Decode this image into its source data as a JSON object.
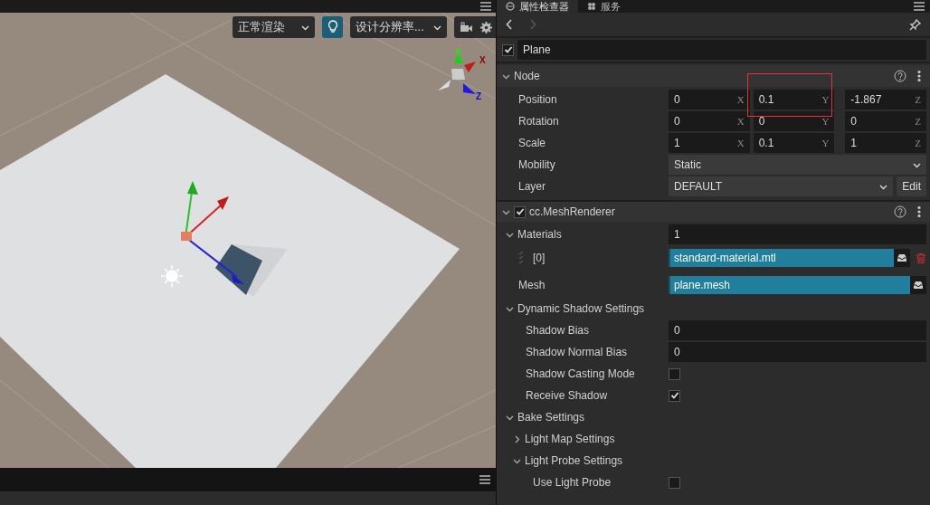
{
  "scene": {
    "toolbar": {
      "render_mode": "正常渲染",
      "light_toggle": {
        "on": true
      },
      "resolution": "设计分辨率..."
    },
    "axis_labels": [
      "Y",
      "X",
      "Z"
    ]
  },
  "inspector": {
    "tabs": [
      {
        "label": "属性检查器",
        "selected": true
      },
      {
        "label": "服务",
        "selected": false
      }
    ],
    "history": {
      "back_disabled": false,
      "forward_disabled": true
    },
    "node": {
      "enabled": true,
      "name": "Plane"
    },
    "annotations": [
      {
        "kind": "rectangle",
        "color": "#e0333a"
      }
    ],
    "sections": [
      {
        "title": "Node",
        "expanded": true,
        "rows": [
          {
            "kind": "vec3",
            "label": "Position",
            "values": [
              {
                "value": "0",
                "axis": "X"
              },
              {
                "value": "0.1",
                "axis": "Y"
              },
              {
                "value": "-1.867",
                "axis": "Z"
              }
            ]
          },
          {
            "kind": "vec3",
            "label": "Rotation",
            "values": [
              {
                "value": "0",
                "axis": "X"
              },
              {
                "value": "0",
                "axis": "Y"
              },
              {
                "value": "0",
                "axis": "Z"
              }
            ]
          },
          {
            "kind": "vec3",
            "label": "Scale",
            "values": [
              {
                "value": "1",
                "axis": "X"
              },
              {
                "value": "0.1",
                "axis": "Y"
              },
              {
                "value": "1",
                "axis": "Z"
              }
            ]
          },
          {
            "kind": "select",
            "label": "Mobility",
            "value": "Static"
          },
          {
            "kind": "select",
            "label": "Layer",
            "value": "DEFAULT",
            "button": "Edit"
          }
        ]
      },
      {
        "title": "cc.MeshRenderer",
        "enabled": true,
        "expanded": true,
        "rows": [
          {
            "kind": "group",
            "label": "Materials",
            "expanded": true,
            "value": "1",
            "children": [
              {
                "kind": "asset",
                "label": "[0]",
                "value": "standard-material.mtl",
                "removable": true
              }
            ]
          },
          {
            "kind": "asset",
            "label": "Mesh",
            "value": "plane.mesh"
          },
          {
            "kind": "group",
            "label": "Dynamic Shadow Settings",
            "expanded": true,
            "children": [
              {
                "kind": "number",
                "label": "Shadow Bias",
                "value": "0"
              },
              {
                "kind": "number",
                "label": "Shadow Normal Bias",
                "value": "0"
              },
              {
                "kind": "checkbox",
                "label": "Shadow Casting Mode",
                "checked": false
              },
              {
                "kind": "checkbox",
                "label": "Receive Shadow",
                "checked": true
              }
            ]
          },
          {
            "kind": "group",
            "label": "Bake Settings",
            "expanded": true,
            "children": [
              {
                "kind": "group",
                "label": "Light Map Settings",
                "expanded": false
              },
              {
                "kind": "group",
                "label": "Light Probe Settings",
                "expanded": true,
                "children": [
                  {
                    "kind": "checkbox",
                    "label": "Use Light Probe",
                    "checked": false
                  }
                ]
              }
            ]
          }
        ]
      }
    ]
  }
}
